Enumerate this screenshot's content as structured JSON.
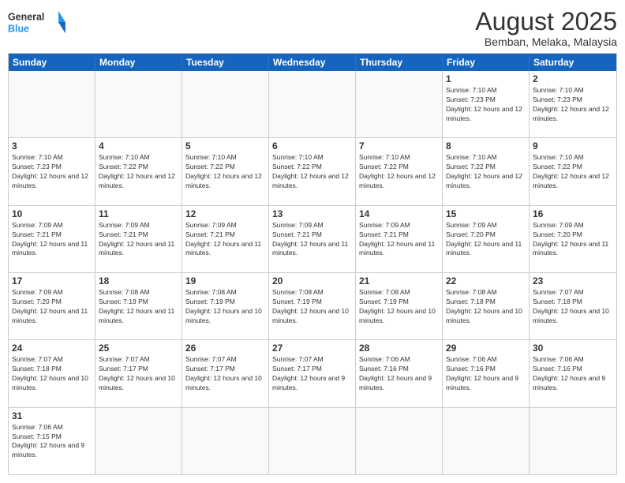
{
  "header": {
    "logo_general": "General",
    "logo_blue": "Blue",
    "month_title": "August 2025",
    "location": "Bemban, Melaka, Malaysia"
  },
  "weekdays": [
    "Sunday",
    "Monday",
    "Tuesday",
    "Wednesday",
    "Thursday",
    "Friday",
    "Saturday"
  ],
  "weeks": [
    {
      "cells": [
        {
          "day": "",
          "empty": true
        },
        {
          "day": "",
          "empty": true
        },
        {
          "day": "",
          "empty": true
        },
        {
          "day": "",
          "empty": true
        },
        {
          "day": "",
          "empty": true
        },
        {
          "day": "1",
          "sunrise": "7:10 AM",
          "sunset": "7:23 PM",
          "daylight": "12 hours and 12 minutes."
        },
        {
          "day": "2",
          "sunrise": "7:10 AM",
          "sunset": "7:23 PM",
          "daylight": "12 hours and 12 minutes."
        }
      ]
    },
    {
      "cells": [
        {
          "day": "3",
          "sunrise": "7:10 AM",
          "sunset": "7:23 PM",
          "daylight": "12 hours and 12 minutes."
        },
        {
          "day": "4",
          "sunrise": "7:10 AM",
          "sunset": "7:22 PM",
          "daylight": "12 hours and 12 minutes."
        },
        {
          "day": "5",
          "sunrise": "7:10 AM",
          "sunset": "7:22 PM",
          "daylight": "12 hours and 12 minutes."
        },
        {
          "day": "6",
          "sunrise": "7:10 AM",
          "sunset": "7:22 PM",
          "daylight": "12 hours and 12 minutes."
        },
        {
          "day": "7",
          "sunrise": "7:10 AM",
          "sunset": "7:22 PM",
          "daylight": "12 hours and 12 minutes."
        },
        {
          "day": "8",
          "sunrise": "7:10 AM",
          "sunset": "7:22 PM",
          "daylight": "12 hours and 12 minutes."
        },
        {
          "day": "9",
          "sunrise": "7:10 AM",
          "sunset": "7:22 PM",
          "daylight": "12 hours and 12 minutes."
        }
      ]
    },
    {
      "cells": [
        {
          "day": "10",
          "sunrise": "7:09 AM",
          "sunset": "7:21 PM",
          "daylight": "12 hours and 11 minutes."
        },
        {
          "day": "11",
          "sunrise": "7:09 AM",
          "sunset": "7:21 PM",
          "daylight": "12 hours and 11 minutes."
        },
        {
          "day": "12",
          "sunrise": "7:09 AM",
          "sunset": "7:21 PM",
          "daylight": "12 hours and 11 minutes."
        },
        {
          "day": "13",
          "sunrise": "7:09 AM",
          "sunset": "7:21 PM",
          "daylight": "12 hours and 11 minutes."
        },
        {
          "day": "14",
          "sunrise": "7:09 AM",
          "sunset": "7:21 PM",
          "daylight": "12 hours and 11 minutes."
        },
        {
          "day": "15",
          "sunrise": "7:09 AM",
          "sunset": "7:20 PM",
          "daylight": "12 hours and 11 minutes."
        },
        {
          "day": "16",
          "sunrise": "7:09 AM",
          "sunset": "7:20 PM",
          "daylight": "12 hours and 11 minutes."
        }
      ]
    },
    {
      "cells": [
        {
          "day": "17",
          "sunrise": "7:09 AM",
          "sunset": "7:20 PM",
          "daylight": "12 hours and 11 minutes."
        },
        {
          "day": "18",
          "sunrise": "7:08 AM",
          "sunset": "7:19 PM",
          "daylight": "12 hours and 11 minutes."
        },
        {
          "day": "19",
          "sunrise": "7:08 AM",
          "sunset": "7:19 PM",
          "daylight": "12 hours and 10 minutes."
        },
        {
          "day": "20",
          "sunrise": "7:08 AM",
          "sunset": "7:19 PM",
          "daylight": "12 hours and 10 minutes."
        },
        {
          "day": "21",
          "sunrise": "7:08 AM",
          "sunset": "7:19 PM",
          "daylight": "12 hours and 10 minutes."
        },
        {
          "day": "22",
          "sunrise": "7:08 AM",
          "sunset": "7:18 PM",
          "daylight": "12 hours and 10 minutes."
        },
        {
          "day": "23",
          "sunrise": "7:07 AM",
          "sunset": "7:18 PM",
          "daylight": "12 hours and 10 minutes."
        }
      ]
    },
    {
      "cells": [
        {
          "day": "24",
          "sunrise": "7:07 AM",
          "sunset": "7:18 PM",
          "daylight": "12 hours and 10 minutes."
        },
        {
          "day": "25",
          "sunrise": "7:07 AM",
          "sunset": "7:17 PM",
          "daylight": "12 hours and 10 minutes."
        },
        {
          "day": "26",
          "sunrise": "7:07 AM",
          "sunset": "7:17 PM",
          "daylight": "12 hours and 10 minutes."
        },
        {
          "day": "27",
          "sunrise": "7:07 AM",
          "sunset": "7:17 PM",
          "daylight": "12 hours and 9 minutes."
        },
        {
          "day": "28",
          "sunrise": "7:06 AM",
          "sunset": "7:16 PM",
          "daylight": "12 hours and 9 minutes."
        },
        {
          "day": "29",
          "sunrise": "7:06 AM",
          "sunset": "7:16 PM",
          "daylight": "12 hours and 9 minutes."
        },
        {
          "day": "30",
          "sunrise": "7:06 AM",
          "sunset": "7:16 PM",
          "daylight": "12 hours and 9 minutes."
        }
      ]
    },
    {
      "cells": [
        {
          "day": "31",
          "sunrise": "7:06 AM",
          "sunset": "7:15 PM",
          "daylight": "12 hours and 9 minutes."
        },
        {
          "day": "",
          "empty": true
        },
        {
          "day": "",
          "empty": true
        },
        {
          "day": "",
          "empty": true
        },
        {
          "day": "",
          "empty": true
        },
        {
          "day": "",
          "empty": true
        },
        {
          "day": "",
          "empty": true
        }
      ]
    }
  ]
}
